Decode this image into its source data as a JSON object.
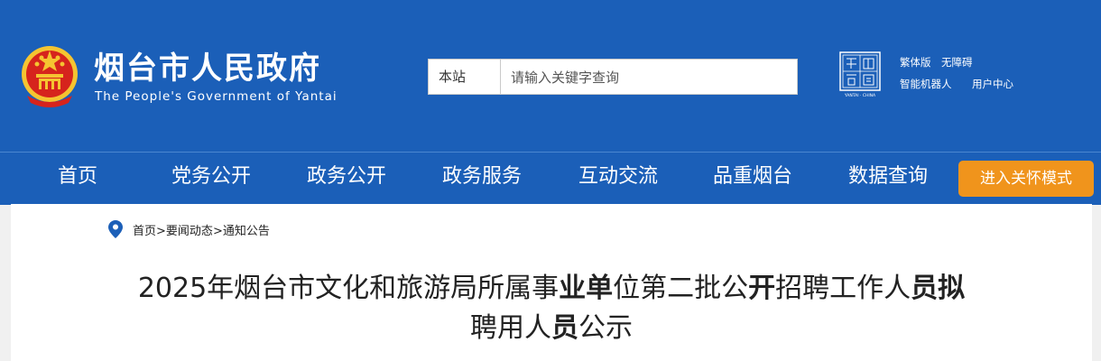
{
  "header": {
    "title": "烟台市人民政府",
    "subtitle": "The People's Government of Yantai",
    "emblem_icon": "national-emblem-icon",
    "china_logo_caption": "YANTAI · CHINA"
  },
  "search": {
    "scope_label": "本站",
    "placeholder": "请输入关键字查询"
  },
  "utility_links": [
    "繁体版",
    "无障碍",
    "智能机器人",
    "用户中心"
  ],
  "nav": {
    "items": [
      "首页",
      "党务公开",
      "政务公开",
      "政务服务",
      "互动交流",
      "品重烟台",
      "数据查询"
    ],
    "care_button": "进入关怀模式"
  },
  "breadcrumb": {
    "icon": "location-pin-icon",
    "items": [
      "首页",
      "要闻动态",
      "通知公告"
    ],
    "separator": ">"
  },
  "article": {
    "title_line1_parts": [
      "2025年烟台市文化和旅游局所属事",
      "业单",
      "位第二批公",
      "开",
      "招聘工作人",
      "员拟"
    ],
    "title_line2_parts": [
      "聘用人",
      "员",
      "公示"
    ]
  },
  "colors": {
    "header_blue": "#1b5fb8",
    "care_orange": "#f0941c",
    "emblem_red": "#d6241d",
    "emblem_gold": "#f5c431"
  }
}
